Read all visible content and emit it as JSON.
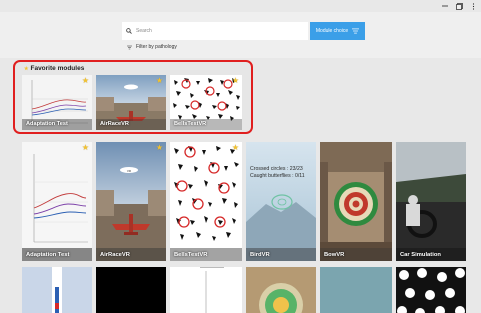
{
  "window": {
    "minimize_icon": "minimize-icon",
    "restore_icon": "restore-icon",
    "more_icon": "more-vertical-icon"
  },
  "search": {
    "placeholder": "Search",
    "icon": "search-icon"
  },
  "module_choice": {
    "label": "Module choice",
    "icon": "filter-list-icon",
    "color": "#3b9fe8"
  },
  "filter": {
    "label": "Filter by pathology",
    "icon": "filter-icon"
  },
  "favorites": {
    "title": "Favorite modules",
    "border_color": "#e01f1f",
    "items": [
      {
        "label": "Adaptation Test",
        "starred": true
      },
      {
        "label": "AirRaceVR",
        "starred": true
      },
      {
        "label": "BellsTestVR",
        "starred": true
      }
    ]
  },
  "modules": [
    {
      "label": "Adaptation Test",
      "starred": true
    },
    {
      "label": "AirRaceVR",
      "starred": true
    },
    {
      "label": "BellsTestVR",
      "starred": true
    },
    {
      "label": "BirdVR",
      "starred": false,
      "overlay_text": [
        "Crossed circles : 23/23",
        "Caught butterflies : 0/11"
      ]
    },
    {
      "label": "BowVR",
      "starred": false
    },
    {
      "label": "Car Simulation",
      "starred": false
    }
  ],
  "modules_row2_count": 6
}
